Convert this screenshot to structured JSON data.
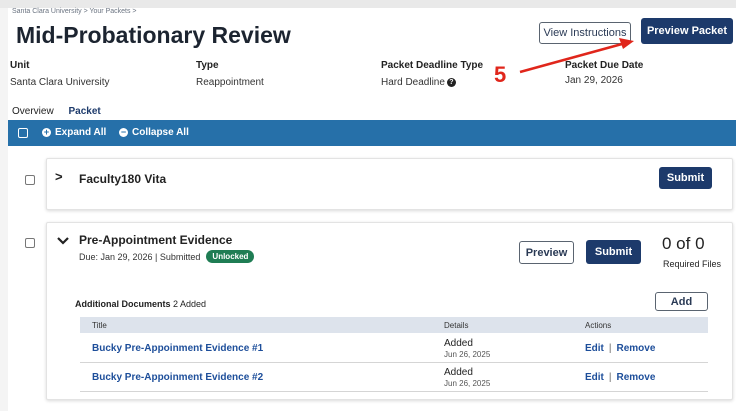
{
  "breadcrumb": "Santa Clara University  >  Your Packets  >",
  "page_title": "Mid-Probationary Review",
  "header_buttons": {
    "view_instructions": "View Instructions",
    "preview_packet": "Preview Packet"
  },
  "meta": [
    {
      "label": "Unit",
      "value": "Santa Clara University"
    },
    {
      "label": "Type",
      "value": "Reappointment"
    },
    {
      "label": "Packet Deadline Type",
      "value": "Hard Deadline"
    },
    {
      "label": "Packet Due Date",
      "value": "Jan 29, 2026"
    }
  ],
  "annotation": {
    "number": "5",
    "color": "#e0261b"
  },
  "tabs": [
    {
      "label": "Overview",
      "active": false
    },
    {
      "label": "Packet",
      "active": true
    }
  ],
  "toolbar": {
    "expand_all": "Expand All",
    "collapse_all": "Collapse All"
  },
  "sections": [
    {
      "title": "Faculty180 Vita",
      "submit_label": "Submit",
      "expanded": false
    },
    {
      "title": "Pre-Appointment Evidence",
      "expanded": true,
      "due_text": "Due: Jan 29, 2026 | Submitted",
      "status_badge": "Unlocked",
      "preview_label": "Preview",
      "submit_label": "Submit",
      "count": "0 of 0",
      "count_label": "Required Files",
      "additional": {
        "label": "Additional Documents",
        "count_text": "2 Added",
        "add_label": "Add"
      },
      "table": {
        "headers": [
          "Title",
          "Details",
          "Actions"
        ],
        "rows": [
          {
            "title": "Bucky Pre-Appoinment Evidence #1",
            "detail": "Added",
            "date": "Jun 26, 2025",
            "edit": "Edit",
            "remove": "Remove"
          },
          {
            "title": "Bucky Pre-Appoinment Evidence #2",
            "detail": "Added",
            "date": "Jun 26, 2025",
            "edit": "Edit",
            "remove": "Remove"
          }
        ]
      }
    }
  ],
  "colors": {
    "primary": "#1d3a6b",
    "bar": "#2670a9",
    "badge": "#1f7d54",
    "link": "#1d4e9a"
  }
}
